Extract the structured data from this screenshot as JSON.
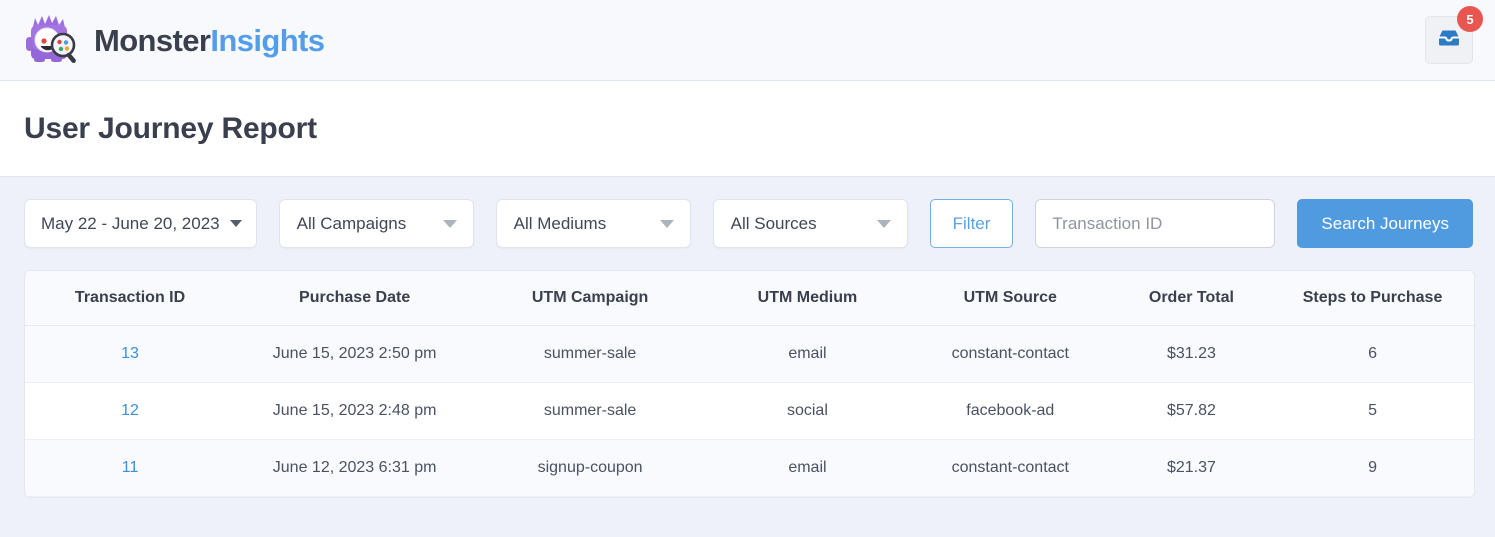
{
  "topbar": {
    "brand_monster": "Monster",
    "brand_insights": "Insights",
    "mascot_icon": "monster-mascot-magnifier-icon",
    "notification_icon": "inbox-tray-icon",
    "notification_count": "5"
  },
  "header": {
    "title": "User Journey Report"
  },
  "filters": {
    "date_range": "May 22 - June 20, 2023",
    "date_caret_icon": "chevron-down-icon",
    "campaign_select": "All Campaigns",
    "medium_select": "All Mediums",
    "source_select": "All Sources",
    "filter_button": "Filter",
    "search_placeholder": "Transaction ID",
    "search_value": "",
    "search_button": "Search Journeys"
  },
  "table": {
    "columns": [
      "Transaction ID",
      "Purchase Date",
      "UTM Campaign",
      "UTM Medium",
      "UTM Source",
      "Order Total",
      "Steps to Purchase"
    ],
    "rows": [
      {
        "transaction_id": "13",
        "purchase_date": "June 15, 2023 2:50 pm",
        "utm_campaign": "summer-sale",
        "utm_medium": "email",
        "utm_source": "constant-contact",
        "order_total": "$31.23",
        "steps_to_purchase": "6"
      },
      {
        "transaction_id": "12",
        "purchase_date": "June 15, 2023 2:48 pm",
        "utm_campaign": "summer-sale",
        "utm_medium": "social",
        "utm_source": "facebook-ad",
        "order_total": "$57.82",
        "steps_to_purchase": "5"
      },
      {
        "transaction_id": "11",
        "purchase_date": "June 12, 2023 6:31 pm",
        "utm_campaign": "signup-coupon",
        "utm_medium": "email",
        "utm_source": "constant-contact",
        "order_total": "$21.37",
        "steps_to_purchase": "9"
      }
    ]
  },
  "colors": {
    "accent_blue": "#509ae0",
    "link_blue": "#3e8fd6",
    "badge_red": "#e8564f",
    "page_bg": "#eef1fa",
    "brand_dark": "#393f4c"
  }
}
